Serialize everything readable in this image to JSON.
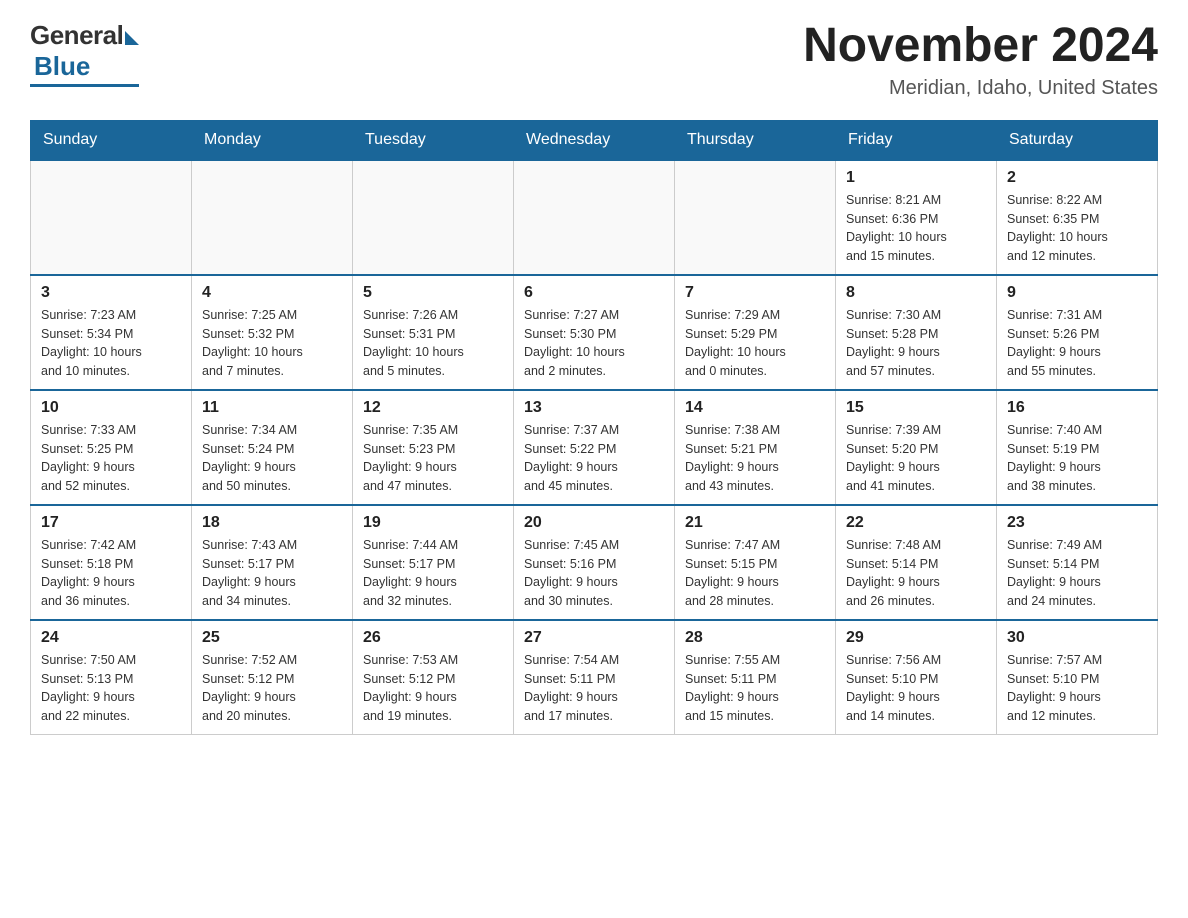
{
  "header": {
    "logo_general": "General",
    "logo_blue": "Blue",
    "month_title": "November 2024",
    "location": "Meridian, Idaho, United States"
  },
  "weekdays": [
    "Sunday",
    "Monday",
    "Tuesday",
    "Wednesday",
    "Thursday",
    "Friday",
    "Saturday"
  ],
  "weeks": [
    [
      {
        "day": "",
        "info": ""
      },
      {
        "day": "",
        "info": ""
      },
      {
        "day": "",
        "info": ""
      },
      {
        "day": "",
        "info": ""
      },
      {
        "day": "",
        "info": ""
      },
      {
        "day": "1",
        "info": "Sunrise: 8:21 AM\nSunset: 6:36 PM\nDaylight: 10 hours\nand 15 minutes."
      },
      {
        "day": "2",
        "info": "Sunrise: 8:22 AM\nSunset: 6:35 PM\nDaylight: 10 hours\nand 12 minutes."
      }
    ],
    [
      {
        "day": "3",
        "info": "Sunrise: 7:23 AM\nSunset: 5:34 PM\nDaylight: 10 hours\nand 10 minutes."
      },
      {
        "day": "4",
        "info": "Sunrise: 7:25 AM\nSunset: 5:32 PM\nDaylight: 10 hours\nand 7 minutes."
      },
      {
        "day": "5",
        "info": "Sunrise: 7:26 AM\nSunset: 5:31 PM\nDaylight: 10 hours\nand 5 minutes."
      },
      {
        "day": "6",
        "info": "Sunrise: 7:27 AM\nSunset: 5:30 PM\nDaylight: 10 hours\nand 2 minutes."
      },
      {
        "day": "7",
        "info": "Sunrise: 7:29 AM\nSunset: 5:29 PM\nDaylight: 10 hours\nand 0 minutes."
      },
      {
        "day": "8",
        "info": "Sunrise: 7:30 AM\nSunset: 5:28 PM\nDaylight: 9 hours\nand 57 minutes."
      },
      {
        "day": "9",
        "info": "Sunrise: 7:31 AM\nSunset: 5:26 PM\nDaylight: 9 hours\nand 55 minutes."
      }
    ],
    [
      {
        "day": "10",
        "info": "Sunrise: 7:33 AM\nSunset: 5:25 PM\nDaylight: 9 hours\nand 52 minutes."
      },
      {
        "day": "11",
        "info": "Sunrise: 7:34 AM\nSunset: 5:24 PM\nDaylight: 9 hours\nand 50 minutes."
      },
      {
        "day": "12",
        "info": "Sunrise: 7:35 AM\nSunset: 5:23 PM\nDaylight: 9 hours\nand 47 minutes."
      },
      {
        "day": "13",
        "info": "Sunrise: 7:37 AM\nSunset: 5:22 PM\nDaylight: 9 hours\nand 45 minutes."
      },
      {
        "day": "14",
        "info": "Sunrise: 7:38 AM\nSunset: 5:21 PM\nDaylight: 9 hours\nand 43 minutes."
      },
      {
        "day": "15",
        "info": "Sunrise: 7:39 AM\nSunset: 5:20 PM\nDaylight: 9 hours\nand 41 minutes."
      },
      {
        "day": "16",
        "info": "Sunrise: 7:40 AM\nSunset: 5:19 PM\nDaylight: 9 hours\nand 38 minutes."
      }
    ],
    [
      {
        "day": "17",
        "info": "Sunrise: 7:42 AM\nSunset: 5:18 PM\nDaylight: 9 hours\nand 36 minutes."
      },
      {
        "day": "18",
        "info": "Sunrise: 7:43 AM\nSunset: 5:17 PM\nDaylight: 9 hours\nand 34 minutes."
      },
      {
        "day": "19",
        "info": "Sunrise: 7:44 AM\nSunset: 5:17 PM\nDaylight: 9 hours\nand 32 minutes."
      },
      {
        "day": "20",
        "info": "Sunrise: 7:45 AM\nSunset: 5:16 PM\nDaylight: 9 hours\nand 30 minutes."
      },
      {
        "day": "21",
        "info": "Sunrise: 7:47 AM\nSunset: 5:15 PM\nDaylight: 9 hours\nand 28 minutes."
      },
      {
        "day": "22",
        "info": "Sunrise: 7:48 AM\nSunset: 5:14 PM\nDaylight: 9 hours\nand 26 minutes."
      },
      {
        "day": "23",
        "info": "Sunrise: 7:49 AM\nSunset: 5:14 PM\nDaylight: 9 hours\nand 24 minutes."
      }
    ],
    [
      {
        "day": "24",
        "info": "Sunrise: 7:50 AM\nSunset: 5:13 PM\nDaylight: 9 hours\nand 22 minutes."
      },
      {
        "day": "25",
        "info": "Sunrise: 7:52 AM\nSunset: 5:12 PM\nDaylight: 9 hours\nand 20 minutes."
      },
      {
        "day": "26",
        "info": "Sunrise: 7:53 AM\nSunset: 5:12 PM\nDaylight: 9 hours\nand 19 minutes."
      },
      {
        "day": "27",
        "info": "Sunrise: 7:54 AM\nSunset: 5:11 PM\nDaylight: 9 hours\nand 17 minutes."
      },
      {
        "day": "28",
        "info": "Sunrise: 7:55 AM\nSunset: 5:11 PM\nDaylight: 9 hours\nand 15 minutes."
      },
      {
        "day": "29",
        "info": "Sunrise: 7:56 AM\nSunset: 5:10 PM\nDaylight: 9 hours\nand 14 minutes."
      },
      {
        "day": "30",
        "info": "Sunrise: 7:57 AM\nSunset: 5:10 PM\nDaylight: 9 hours\nand 12 minutes."
      }
    ]
  ]
}
